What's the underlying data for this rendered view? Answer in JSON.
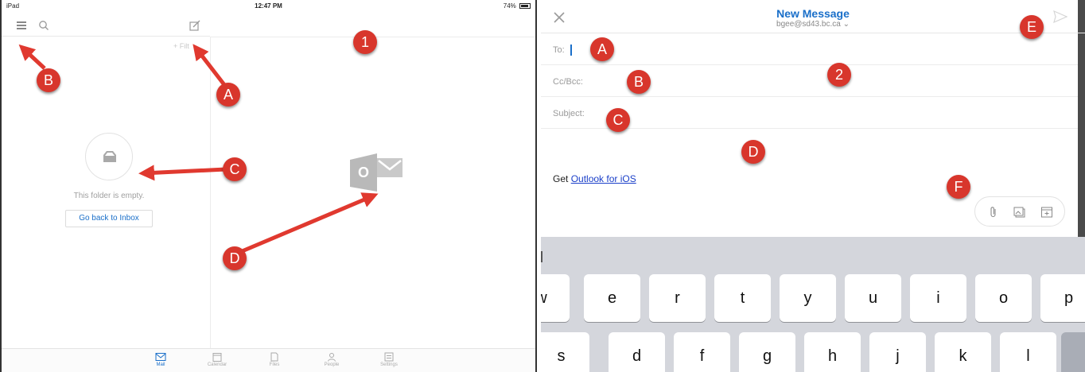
{
  "left": {
    "status": {
      "device": "iPad",
      "time": "12:47 PM",
      "battery": "74%"
    },
    "filter_label": "+ Filt",
    "empty_text": "This folder is empty.",
    "go_back_label": "Go back to Inbox",
    "logo_letter": "O",
    "tabs": [
      {
        "label": "Mail",
        "icon": "mail-icon",
        "active": true
      },
      {
        "label": "Calendar",
        "icon": "calendar-icon",
        "active": false
      },
      {
        "label": "Files",
        "icon": "files-icon",
        "active": false
      },
      {
        "label": "People",
        "icon": "people-icon",
        "active": false
      },
      {
        "label": "Settings",
        "icon": "settings-icon",
        "active": false
      }
    ]
  },
  "right": {
    "title": "New Message",
    "account": "bgee@sd43.bc.ca",
    "fields": {
      "to_label": "To:",
      "cc_label": "Cc/Bcc:",
      "subject_label": "Subject:"
    },
    "body_prefix": "Get ",
    "body_link": "Outlook for iOS",
    "keyboard": {
      "row1": [
        "w",
        "e",
        "r",
        "t",
        "y",
        "u",
        "i",
        "o",
        "p"
      ],
      "row2": [
        "s",
        "d",
        "f",
        "g",
        "h",
        "j",
        "k",
        "l"
      ]
    }
  },
  "annotations": {
    "left_number": "1",
    "right_number": "2",
    "left_letters": [
      "A",
      "B",
      "C",
      "D"
    ],
    "right_letters": [
      "A",
      "B",
      "C",
      "D",
      "E",
      "F"
    ]
  },
  "colors": {
    "accent": "#1a6fc9",
    "badge": "#d8362c",
    "keyboard_bg": "#d4d6dc"
  }
}
